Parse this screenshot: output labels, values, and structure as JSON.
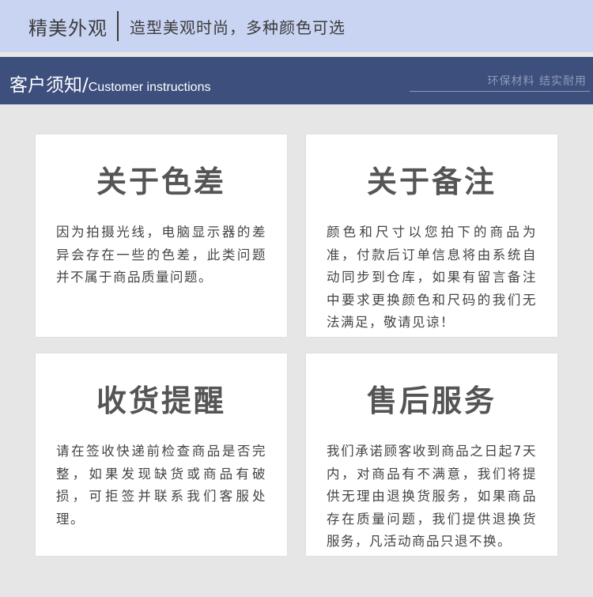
{
  "header": {
    "title": "精美外观",
    "subtitle": "造型美观时尚，多种颜色可选"
  },
  "banner": {
    "title_cn": "客户须知",
    "title_sep": "/",
    "title_en": "Customer instructions",
    "right_text": "环保材料 结实耐用"
  },
  "cards": [
    {
      "title": "关于色差",
      "body": "因为拍摄光线，电脑显示器的差异会存在一些的色差，此类问题并不属于商品质量问题。"
    },
    {
      "title": "关于备注",
      "body": "颜色和尺寸以您拍下的商品为准，付款后订单信息将由系统自动同步到仓库，如果有留言备注中要求更换颜色和尺码的我们无法满足，敬请见谅！"
    },
    {
      "title": "收货提醒",
      "body": "请在签收快递前检查商品是否完整，如果发现缺货或商品有破损，可拒签并联系我们客服处理。"
    },
    {
      "title": "售后服务",
      "body": "我们承诺顾客收到商品之日起7天内，对商品有不满意，我们将提供无理由退换货服务，如果商品存在质量问题，我们提供退换货服务，凡活动商品只退不换。"
    }
  ]
}
